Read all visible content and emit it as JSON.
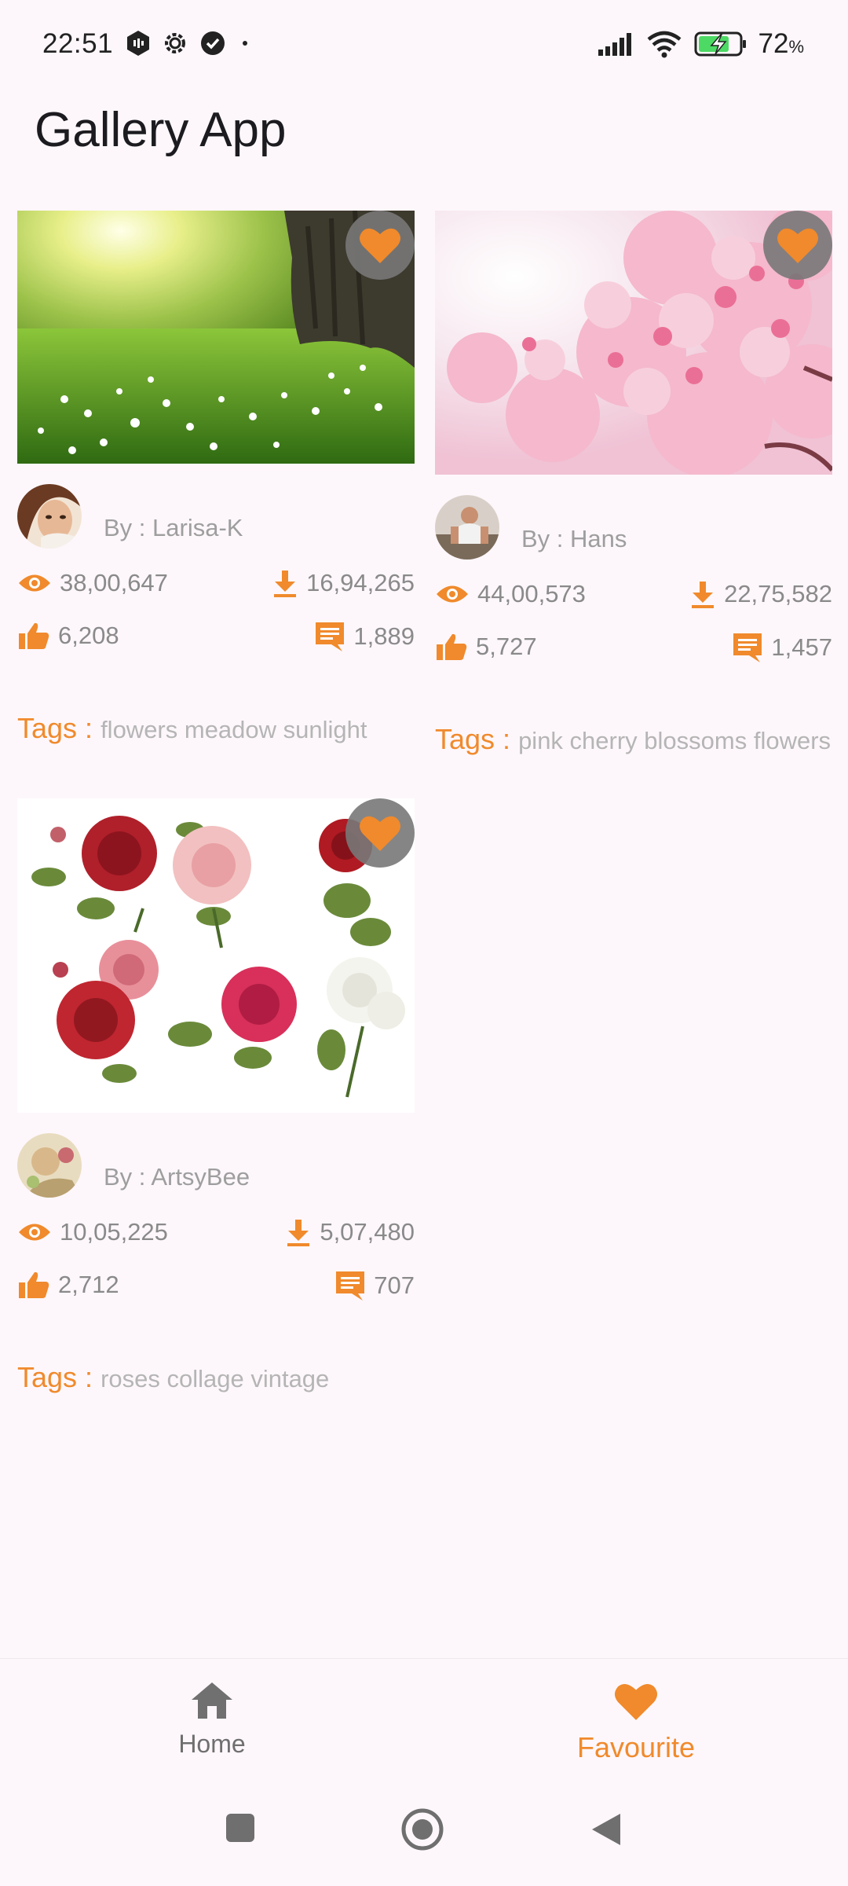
{
  "status_bar": {
    "time": "22:51",
    "battery": "72",
    "battery_unit": "%"
  },
  "app_title": "Gallery App",
  "cards": [
    {
      "author_prefix": "By : ",
      "author": "Larisa-K",
      "views": "38,00,647",
      "downloads": "16,94,265",
      "likes": "6,208",
      "comments": "1,889",
      "tags_label": "Tags : ",
      "tags": "flowers meadow sunlight",
      "image": "meadow-sunlight-photo"
    },
    {
      "author_prefix": "By : ",
      "author": "Hans",
      "views": "44,00,573",
      "downloads": "22,75,582",
      "likes": "5,727",
      "comments": "1,457",
      "tags_label": "Tags : ",
      "tags": "pink cherry blossoms flowers",
      "image": "cherry-blossom-photo"
    },
    {
      "author_prefix": "By : ",
      "author": "ArtsyBee",
      "views": "10,05,225",
      "downloads": "5,07,480",
      "likes": "2,712",
      "comments": "707",
      "tags_label": "Tags : ",
      "tags": "roses collage vintage",
      "image": "vintage-roses-collage"
    }
  ],
  "bottom_nav": {
    "home": "Home",
    "favourite": "Favourite"
  },
  "colors": {
    "accent": "#f08a2c",
    "background": "#fdf7fb",
    "muted": "#9e9e9e"
  },
  "icons": [
    "eye-icon",
    "download-icon",
    "thumb-up-icon",
    "comment-icon",
    "heart-icon",
    "home-icon"
  ]
}
